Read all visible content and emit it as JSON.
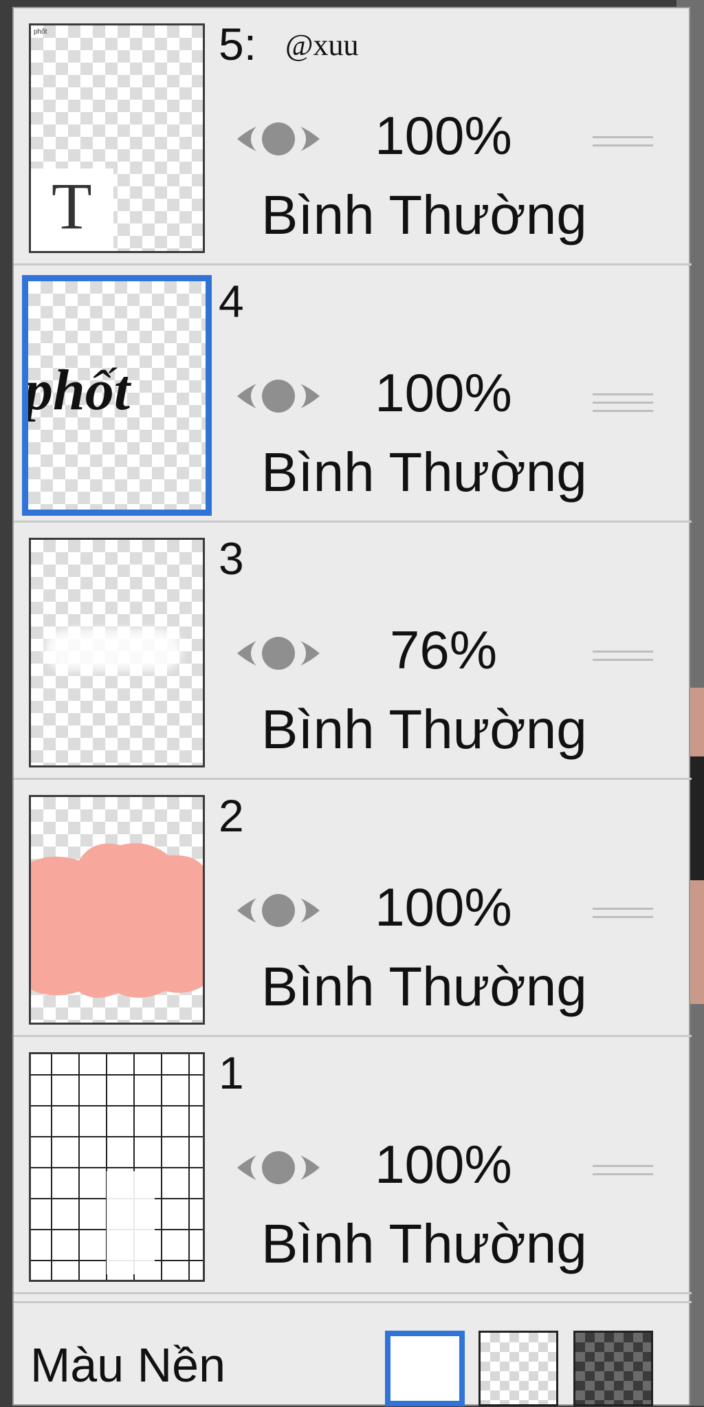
{
  "layers": [
    {
      "number": "5:",
      "name": "@xuu",
      "opacity": "100%",
      "blend_mode": "Bình Thường",
      "visible": true,
      "selected": false,
      "thumbnail": "text-layer",
      "thumb_glyph": "T",
      "thumb_text": "phốt"
    },
    {
      "number": "4",
      "name": "",
      "opacity": "100%",
      "blend_mode": "Bình Thường",
      "visible": true,
      "selected": true,
      "thumbnail": "lettering",
      "thumb_text": "phốt"
    },
    {
      "number": "3",
      "name": "",
      "opacity": "76%",
      "blend_mode": "Bình Thường",
      "visible": true,
      "selected": false,
      "thumbnail": "white-lettering"
    },
    {
      "number": "2",
      "name": "",
      "opacity": "100%",
      "blend_mode": "Bình Thường",
      "visible": true,
      "selected": false,
      "thumbnail": "peach-blob"
    },
    {
      "number": "1",
      "name": "",
      "opacity": "100%",
      "blend_mode": "Bình Thường",
      "visible": true,
      "selected": false,
      "thumbnail": "grid"
    }
  ],
  "footer": {
    "background_label": "Màu Nền",
    "swatches": [
      "white",
      "transparent-checker",
      "dark-checker"
    ],
    "selected_swatch": "white"
  },
  "colors": {
    "accent": "#2f74d6",
    "panel": "#ebebeb",
    "eye": "#8f8f8f",
    "peach": "#f7a79b"
  },
  "icons": {
    "visibility": "eye-icon",
    "reorder": "drag-handle-icon"
  }
}
